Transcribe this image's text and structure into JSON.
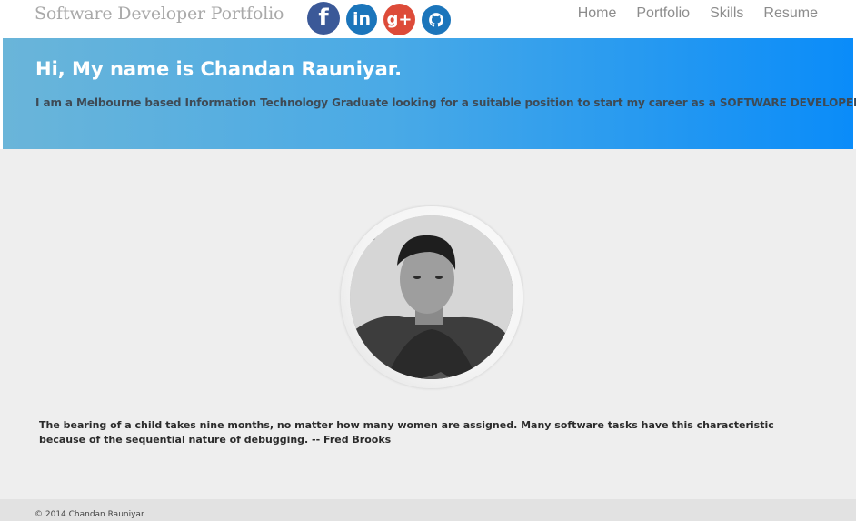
{
  "header": {
    "brand": "Software Developer Portfolio",
    "social": [
      {
        "icon": "facebook-icon",
        "glyph": "f",
        "color": "#3b5998"
      },
      {
        "icon": "linkedin-icon",
        "glyph": "in",
        "color": "#1b75bb"
      },
      {
        "icon": "google-plus-icon",
        "glyph": "g+",
        "color": "#dd4b39"
      },
      {
        "icon": "github-icon",
        "glyph": "",
        "color": "#1b75bb"
      }
    ],
    "nav": {
      "home": "Home",
      "portfolio": "Portfolio",
      "skills": "Skills",
      "resume": "Resume"
    }
  },
  "hero": {
    "title": "Hi, My name is Chandan Rauniyar.",
    "subtitle": "I am a Melbourne based Information Technology Graduate looking for a suitable position to start my career as a SOFTWARE DEVELOPER"
  },
  "main": {
    "quote": "The bearing of a child takes nine months, no matter how many women are assigned. Many software tasks have this characteristic because of the sequential nature of debugging. -- Fred Brooks"
  },
  "footer": {
    "copyright": "© 2014 Chandan Rauniyar"
  },
  "colors": {
    "hero_start": "#6ab5d9",
    "hero_end": "#0a8cf9",
    "page_bg": "#eeeeee",
    "nav_text": "#8c8c8c"
  }
}
